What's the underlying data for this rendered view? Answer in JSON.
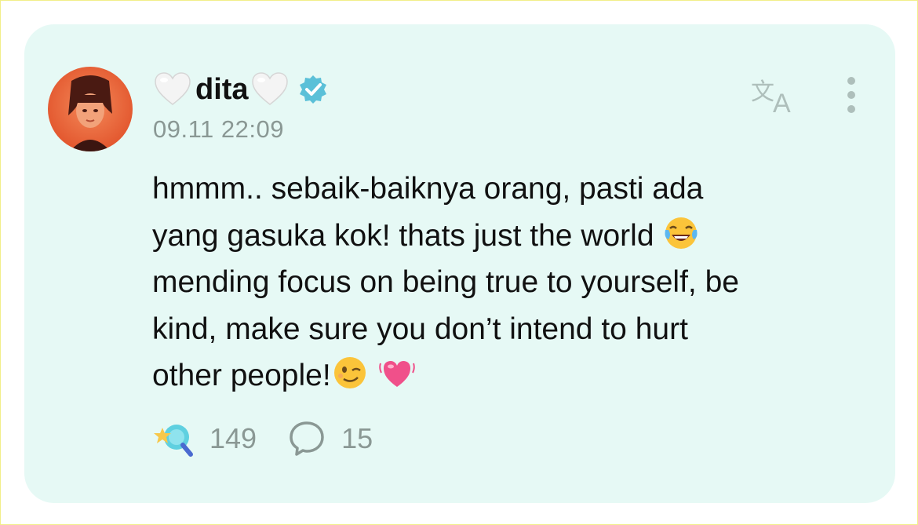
{
  "post": {
    "author": {
      "name": "dita",
      "name_decoration_icon": "white-heart-icon",
      "verified_icon": "verified-badge-icon"
    },
    "timestamp": "09.11 22:09",
    "text_lines": [
      "hmmm.. sebaik-baiknya orang, pasti ada",
      "yang gasuka kok! thats just the world ",
      "mending focus on being true to yourself, be",
      "kind, make sure you don’t intend to hurt",
      "other people!"
    ],
    "emojis": [
      "face-with-tears-of-joy-icon",
      "winking-face-icon",
      "beating-heart-icon"
    ],
    "actions": {
      "like_icon": "star-lollipop-icon",
      "like_count": "149",
      "reply_icon": "speech-bubble-icon",
      "reply_count": "15"
    },
    "toolbar": {
      "translate_icon": "translate-icon",
      "more_icon": "vertical-ellipsis-icon"
    }
  },
  "colors": {
    "card_background": "#e6f9f5",
    "verified_badge": "#5bc0d8",
    "muted_text": "#8a9894",
    "accent_icon": "#aebfbb"
  }
}
